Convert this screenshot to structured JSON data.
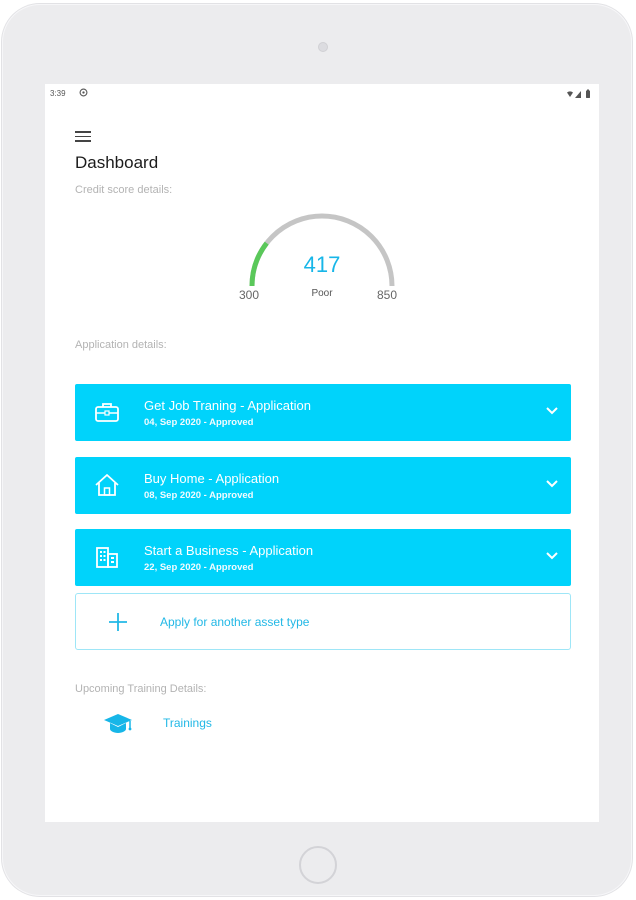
{
  "status_bar": {
    "time": "3:39"
  },
  "header": {
    "title": "Dashboard"
  },
  "credit": {
    "label": "Credit score details:",
    "score": "417",
    "rating": "Poor",
    "min": "300",
    "max": "850",
    "fill_fraction": 0.21,
    "colors": {
      "fill": "#5ac85a",
      "track": "#c5c5c5",
      "value": "#17b6e8"
    }
  },
  "applications": {
    "label": "Application details:",
    "items": [
      {
        "title": "Get Job Traning - Application",
        "subtitle": "04, Sep 2020 - Approved",
        "icon": "briefcase-icon"
      },
      {
        "title": "Buy Home - Application",
        "subtitle": "08, Sep 2020 - Approved",
        "icon": "home-icon"
      },
      {
        "title": "Start a Business - Application",
        "subtitle": "22, Sep 2020 - Approved",
        "icon": "building-icon"
      }
    ],
    "apply_label": "Apply for another asset type",
    "accent": "#00d3fb"
  },
  "training": {
    "label": "Upcoming Training Details:",
    "link_label": "Trainings",
    "icon": "graduation-cap-icon"
  }
}
